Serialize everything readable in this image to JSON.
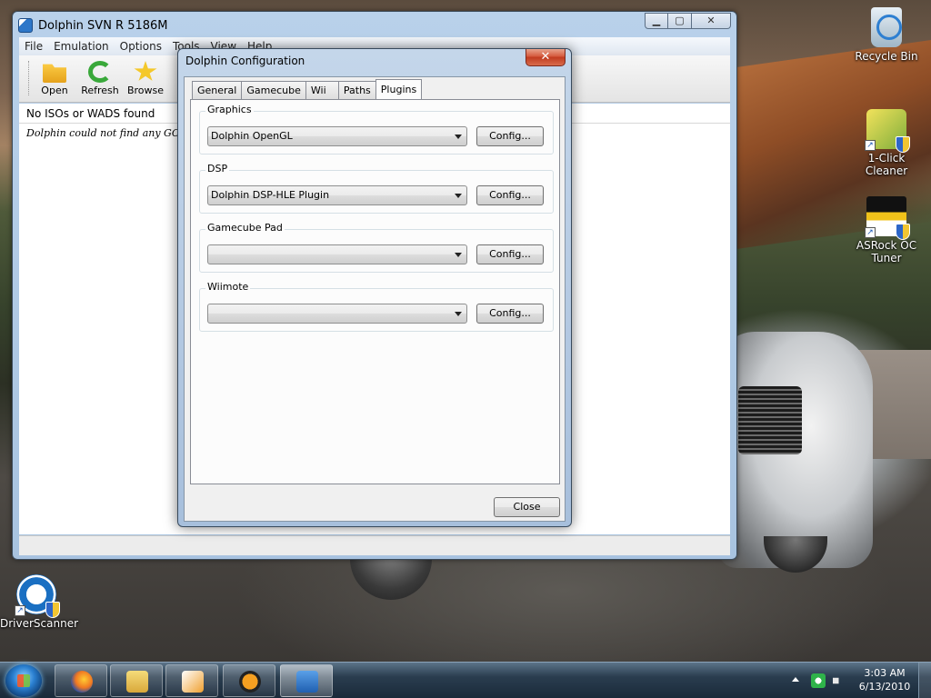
{
  "desktop": {
    "icons": {
      "recycle_bin": "Recycle Bin",
      "one_click_cleaner": "1-Click Cleaner",
      "asrock_oc_tuner": "ASRock OC Tuner",
      "driver_scanner": "DriverScanner"
    }
  },
  "main_window": {
    "title": "Dolphin SVN R 5186M",
    "caption": {
      "minimize": "▁",
      "maximize": "▢",
      "close": "✕"
    },
    "menu": [
      "File",
      "Emulation",
      "Options",
      "Tools",
      "View",
      "Help"
    ],
    "toolbar": {
      "open": "Open",
      "refresh": "Refresh",
      "browse": "Browse"
    },
    "status_strip": "No ISOs or WADS found",
    "content_message": "Dolphin could not find any GC/Wii ISOs. Double-click here to browse for files..."
  },
  "config_dialog": {
    "title": "Dolphin Configuration",
    "close_glyph": "✕",
    "tabs": [
      "General",
      "Gamecube",
      "Wii",
      "Paths",
      "Plugins"
    ],
    "active_tab": "Plugins",
    "groups": [
      {
        "label": "Graphics",
        "value": "Dolphin OpenGL",
        "button": "Config..."
      },
      {
        "label": "DSP",
        "value": "Dolphin DSP-HLE Plugin",
        "button": "Config..."
      },
      {
        "label": "Gamecube Pad",
        "value": "",
        "button": "Config..."
      },
      {
        "label": "Wiimote",
        "value": "",
        "button": "Config..."
      }
    ],
    "close_button": "Close"
  },
  "taskbar": {
    "time": "3:03 AM",
    "date": "6/13/2010"
  }
}
